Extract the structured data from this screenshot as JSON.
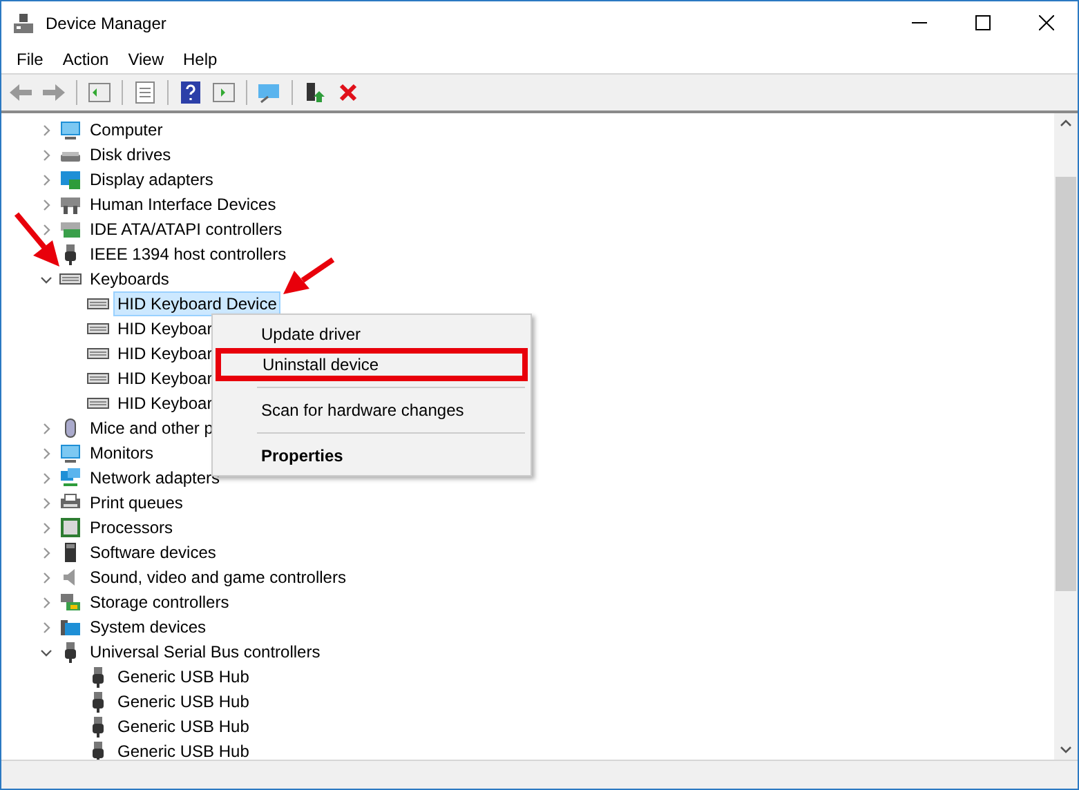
{
  "window": {
    "title": "Device Manager"
  },
  "menu": [
    {
      "label": "File"
    },
    {
      "label": "Action"
    },
    {
      "label": "View"
    },
    {
      "label": "Help"
    }
  ],
  "tree": [
    {
      "label": "Computer",
      "kind": "monitor",
      "expanded": false
    },
    {
      "label": "Disk drives",
      "kind": "disk",
      "expanded": false
    },
    {
      "label": "Display adapters",
      "kind": "display",
      "expanded": false
    },
    {
      "label": "Human Interface Devices",
      "kind": "hid",
      "expanded": false
    },
    {
      "label": "IDE ATA/ATAPI controllers",
      "kind": "ide",
      "expanded": false
    },
    {
      "label": "IEEE 1394 host controllers",
      "kind": "plug"
    },
    {
      "label": "Keyboards",
      "kind": "keyboard",
      "expanded": true,
      "children": [
        {
          "label": "HID Keyboard Device",
          "kind": "keyboard",
          "selected": true
        },
        {
          "label": "HID Keyboar",
          "kind": "keyboard",
          "selected": false
        },
        {
          "label": "HID Keyboar",
          "kind": "keyboard",
          "selected": false
        },
        {
          "label": "HID Keyboar",
          "kind": "keyboard",
          "selected": false
        },
        {
          "label": "HID Keyboar",
          "kind": "keyboard",
          "selected": false
        }
      ]
    },
    {
      "label": "Mice and other p",
      "kind": "mouse",
      "expanded": false
    },
    {
      "label": "Monitors",
      "kind": "monitor",
      "expanded": false
    },
    {
      "label": "Network adapters",
      "kind": "network",
      "expanded": false
    },
    {
      "label": "Print queues",
      "kind": "printer",
      "expanded": false
    },
    {
      "label": "Processors",
      "kind": "chip",
      "expanded": false
    },
    {
      "label": "Software devices",
      "kind": "tower",
      "expanded": false
    },
    {
      "label": "Sound, video and game controllers",
      "kind": "speaker",
      "expanded": false
    },
    {
      "label": "Storage controllers",
      "kind": "storage",
      "expanded": false
    },
    {
      "label": "System devices",
      "kind": "folder",
      "expanded": false
    },
    {
      "label": "Universal Serial Bus controllers",
      "kind": "plug",
      "expanded": true,
      "children": [
        {
          "label": "Generic USB Hub",
          "kind": "plug",
          "selected": false
        },
        {
          "label": "Generic USB Hub",
          "kind": "plug",
          "selected": false
        },
        {
          "label": "Generic USB Hub",
          "kind": "plug",
          "selected": false
        },
        {
          "label": "Generic USB Hub",
          "kind": "plug",
          "selected": false
        }
      ]
    }
  ],
  "context_menu": [
    {
      "label": "Update driver",
      "bold": false,
      "highlighted": false
    },
    {
      "label": "Uninstall device",
      "bold": false,
      "highlighted": true
    },
    {
      "kind": "separator"
    },
    {
      "label": "Scan for hardware changes",
      "bold": false,
      "highlighted": false
    },
    {
      "kind": "separator"
    },
    {
      "label": "Properties",
      "bold": true,
      "highlighted": false
    }
  ]
}
